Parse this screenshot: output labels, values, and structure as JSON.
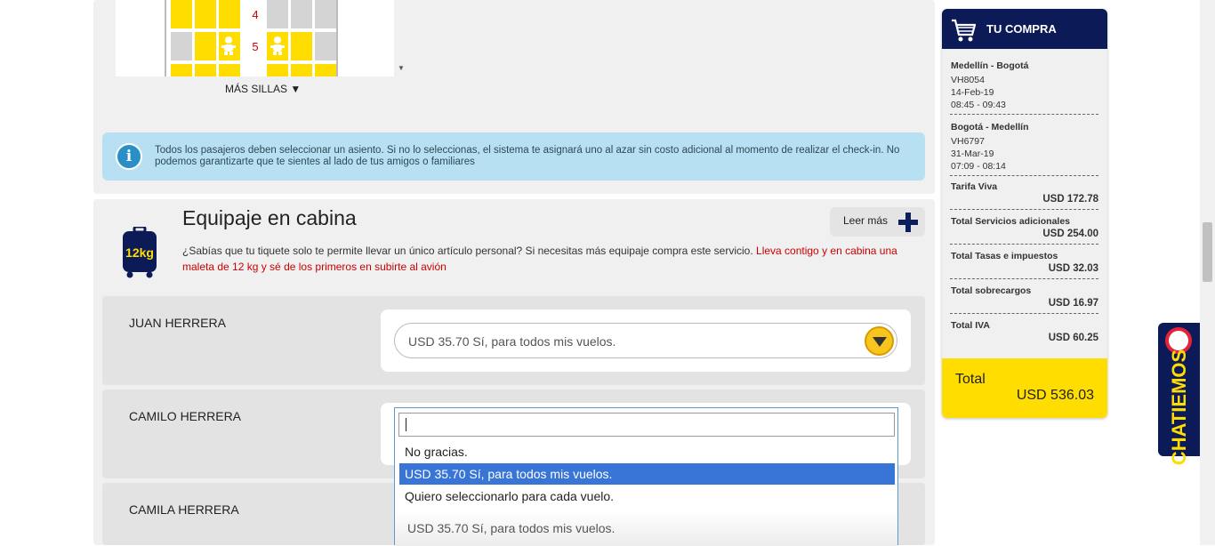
{
  "seatmap": {
    "row_numbers": [
      "4",
      "5"
    ],
    "more_seats_label": "MÁS SILLAS ▼"
  },
  "info_banner": {
    "text": "Todos los pasajeros deben seleccionar un asiento. Si no lo seleccionas, el sistema te asignará uno al azar sin costo adicional al momento de realizar el check-in. No podemos garantizarte que te sientes al lado de tus amigos o familiares"
  },
  "cabin_baggage": {
    "title": "Equipaje en cabina",
    "bag_label": "12kg",
    "description": "¿Sabías que tu tiquete solo te permite llevar un único artículo personal? Si necesitas más equipaje compra este servicio. ",
    "description_highlight": "Lleva contigo y en cabina una maleta de 12 kg y sé de los primeros en subirte al avión",
    "read_more_label": "Leer más"
  },
  "passengers": [
    {
      "name": "JUAN HERRERA",
      "selected": "USD 35.70 Sí, para todos mis vuelos."
    },
    {
      "name": "CAMILO HERRERA",
      "selected": ""
    },
    {
      "name": "CAMILA HERRERA",
      "selected": "USD 35.70 Sí, para todos mis vuelos."
    }
  ],
  "dropdown": {
    "search_value": "",
    "options": [
      "No gracias.",
      "USD 35.70 Sí, para todos mis vuelos.",
      "Quiero seleccionarlo para cada vuelo."
    ],
    "highlighted_index": 1
  },
  "cart": {
    "title": "TU COMPRA",
    "flights": [
      {
        "route": "Medellín - Bogotá",
        "code": "VH8054",
        "date": "14-Feb-19",
        "time": "08:45 - 09:43"
      },
      {
        "route": "Bogotá - Medellín",
        "code": "VH6797",
        "date": "31-Mar-19",
        "time": "07:09 - 08:14"
      }
    ],
    "fare_label": "Tarifa Viva",
    "fare_value": "USD 172.78",
    "lines": [
      {
        "label": "Total Servicios adicionales",
        "value": "USD 254.00"
      },
      {
        "label": "Total Tasas e impuestos",
        "value": "USD 32.03"
      },
      {
        "label": "Total sobrecargos",
        "value": "USD 16.97"
      },
      {
        "label": "Total IVA",
        "value": "USD 60.25"
      }
    ],
    "total_label": "Total",
    "total_value": "USD 536.03"
  },
  "chat": {
    "label": "CHATIEMOS"
  },
  "colors": {
    "brand_navy": "#0c1a57",
    "brand_yellow": "#ffdd00",
    "accent_red": "#cc0000",
    "info_blue": "#b8e0f3"
  }
}
